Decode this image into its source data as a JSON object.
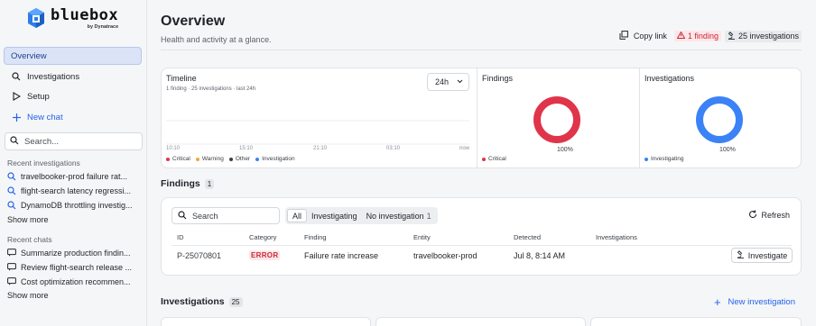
{
  "brand": {
    "name": "bluebox",
    "sub": "by Dynatrace"
  },
  "sidebar": {
    "nav": [
      {
        "label": "Overview",
        "icon": "grid-icon",
        "active": true
      },
      {
        "label": "Investigations",
        "icon": "search-icon"
      },
      {
        "label": "Setup",
        "icon": "play-icon"
      },
      {
        "label": "New chat",
        "icon": "plus-icon"
      }
    ],
    "search_placeholder": "Search...",
    "recent_investigations_label": "Recent investigations",
    "recent_investigations": [
      "travelbooker-prod failure rat...",
      "flight-search latency regressi...",
      "DynamoDB throttling investig..."
    ],
    "show_more_1": "Show more",
    "recent_chats_label": "Recent chats",
    "recent_chats": [
      "Summarize production findin...",
      "Review flight-search release ...",
      "Cost optimization recommen..."
    ],
    "show_more_2": "Show more"
  },
  "header": {
    "title": "Overview",
    "subtitle": "Health and activity at a glance.",
    "copy_link": "Copy link",
    "findings_badge": "1 finding",
    "investigations_badge": "25 investigations"
  },
  "timeline": {
    "title": "Timeline",
    "subtitle": "1 finding · 25 investigations · last 24h",
    "range": "24h",
    "ticks": [
      "10:10",
      "15:10",
      "21:10",
      "03:10",
      "now"
    ],
    "legend": [
      {
        "label": "Critical",
        "color": "#e0344a"
      },
      {
        "label": "Warning",
        "color": "#f2a93b"
      },
      {
        "label": "Other",
        "color": "#3b4047"
      },
      {
        "label": "Investigation",
        "color": "#3b82f6"
      }
    ]
  },
  "findings_panel": {
    "title": "Findings",
    "percent": "100%",
    "fraction": 1.0,
    "legend": "Critical",
    "color": "#e0344a"
  },
  "investigations_panel": {
    "title": "Investigations",
    "percent": "100%",
    "fraction": 1.0,
    "legend": "Investigating",
    "color": "#3b82f6"
  },
  "findings": {
    "title": "Findings",
    "count": "1",
    "search_placeholder": "Search",
    "filters": [
      {
        "label": "All",
        "active": true,
        "count": ""
      },
      {
        "label": "Investigating",
        "active": false,
        "count": ""
      },
      {
        "label": "No investigation",
        "active": false,
        "count": "1"
      }
    ],
    "refresh": "Refresh",
    "columns": [
      "ID",
      "Category",
      "Finding",
      "Entity",
      "Detected",
      "Investigations"
    ],
    "rows": [
      {
        "id": "P-25070801",
        "category": "ERROR",
        "finding": "Failure rate increase",
        "entity": "travelbooker-prod",
        "detected": "Jul 8, 8:14 AM",
        "action": "Investigate"
      }
    ]
  },
  "investigations": {
    "title": "Investigations",
    "count": "25",
    "new_button": "New investigation"
  }
}
